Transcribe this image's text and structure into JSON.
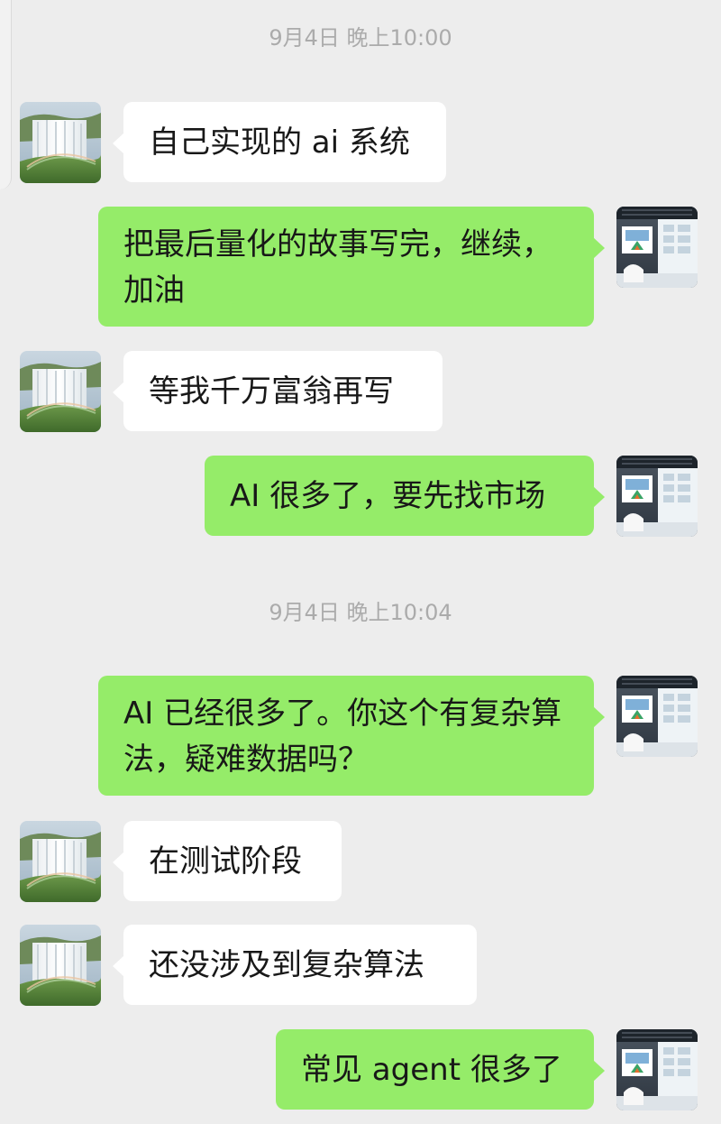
{
  "colors": {
    "background": "#ededed",
    "incoming_bubble": "#ffffff",
    "outgoing_bubble": "#95ec69",
    "timestamp_text": "#ababab"
  },
  "timestamps": [
    "9月4日 晚上10:00",
    "9月4日 晚上10:04"
  ],
  "avatars": {
    "contact": "waterfall-rainbow-avatar",
    "self": "office-room-avatar"
  },
  "messages": [
    {
      "sender": "contact",
      "text": "自己实现的 ai 系统"
    },
    {
      "sender": "self",
      "text": "把最后量化的故事写完，继续，加油"
    },
    {
      "sender": "contact",
      "text": "等我千万富翁再写"
    },
    {
      "sender": "self",
      "text": "AI 很多了，要先找市场"
    },
    {
      "sender": "self",
      "text": "AI 已经很多了。你这个有复杂算法，疑难数据吗？"
    },
    {
      "sender": "contact",
      "text": "在测试阶段"
    },
    {
      "sender": "contact",
      "text": "还没涉及到复杂算法"
    },
    {
      "sender": "self",
      "text": "常见 agent 很多了"
    }
  ]
}
